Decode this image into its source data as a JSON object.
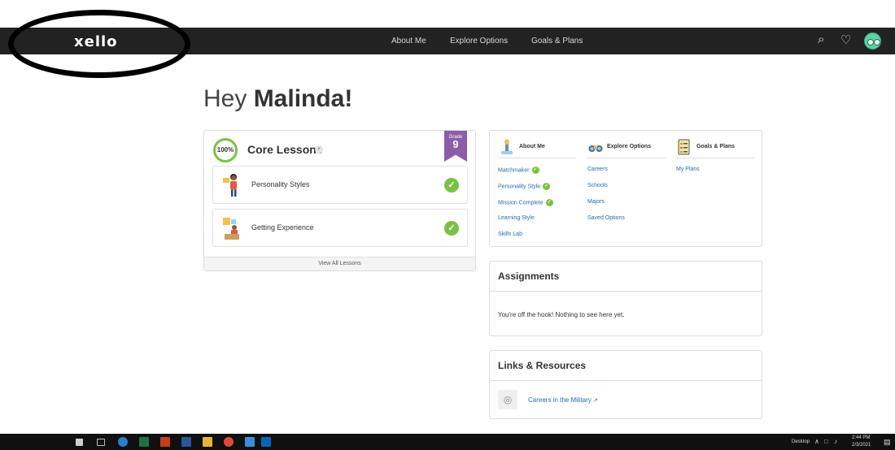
{
  "header": {
    "logo": "xello",
    "nav": [
      "About Me",
      "Explore Options",
      "Goals & Plans"
    ],
    "icons": [
      "search-icon",
      "heart-icon",
      "avatar"
    ]
  },
  "greeting": {
    "prefix": "Hey ",
    "name": "Malinda!"
  },
  "core_lessons": {
    "progress": "100%",
    "title": "Core Lessons",
    "grade_label": "Grade",
    "grade_value": "9",
    "lessons": [
      {
        "label": "Personality Styles",
        "completed": true
      },
      {
        "label": "Getting Experience",
        "completed": true
      }
    ],
    "view_all": "View All Lessons"
  },
  "quick_links": {
    "about_me": {
      "title": "About Me",
      "links": [
        "Matchmaker",
        "Personality Style",
        "Mission Complete",
        "Learning Style",
        "Skills Lab"
      ]
    },
    "explore_options": {
      "title": "Explore Options",
      "links": [
        "Careers",
        "Schools",
        "Majors",
        "Saved Options"
      ]
    },
    "goals_plans": {
      "title": "Goals & Plans",
      "links": [
        "My Plans"
      ]
    }
  },
  "assignments": {
    "title": "Assignments",
    "empty_text": "You're off the hook! Nothing to see here yet."
  },
  "links_resources": {
    "title": "Links & Resources",
    "items": [
      "Careers in the Military"
    ]
  },
  "taskbar": {
    "desktop_label": "Desktop",
    "time": "2:44 PM",
    "date": "2/3/2021"
  },
  "colors": {
    "topbar": "#222222",
    "accent_green": "#7bc143",
    "grade_purple": "#8c5ca8",
    "link_blue": "#1d6fa5"
  }
}
